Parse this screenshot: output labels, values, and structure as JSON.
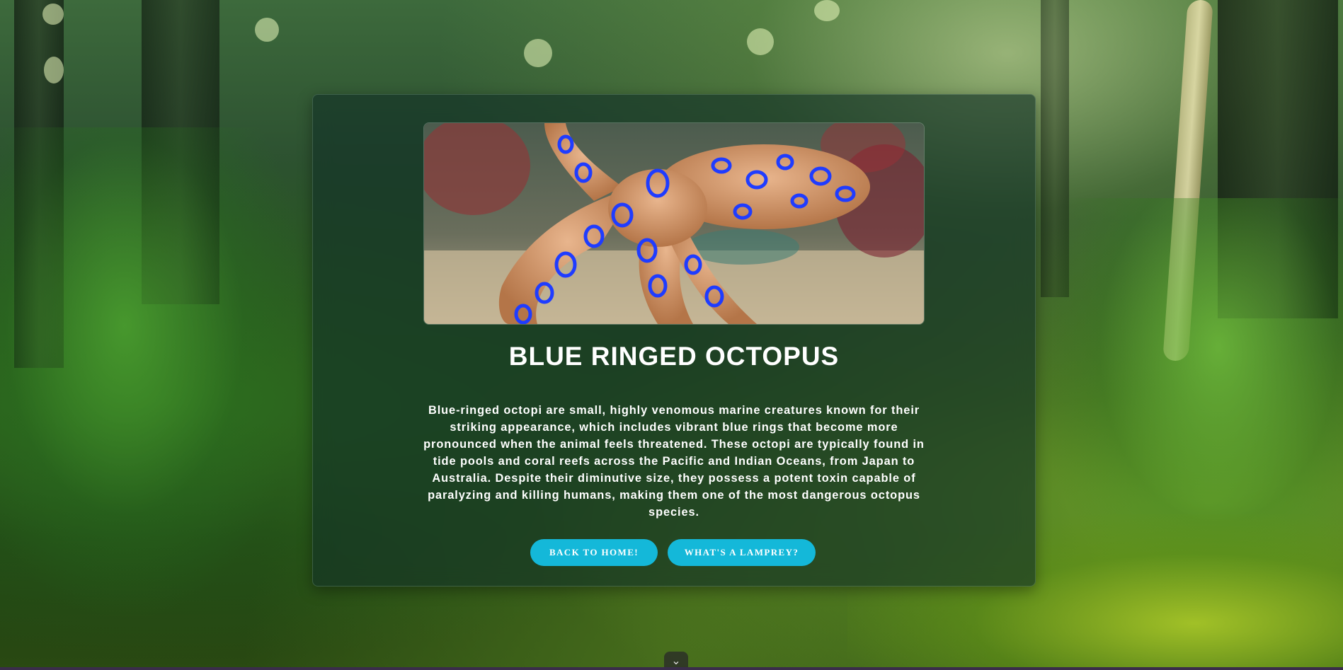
{
  "card": {
    "image_alt": "Blue-ringed octopus on sandy reef",
    "title": "BLUE RINGED OCTOPUS",
    "description": "Blue-ringed octopi are small, highly venomous marine creatures known for their striking appearance, which includes vibrant blue rings that become more pronounced when the animal feels threatened. These octopi are typically found in tide pools and coral reefs across the Pacific and Indian Oceans, from Japan to Australia. Despite their diminutive size, they possess a potent toxin capable of paralyzing and killing humans, making them one of the most dangerous octopus species.",
    "buttons": {
      "home_label": "BACK TO HOME!",
      "lamprey_label": "WHAT'S A LAMPREY?"
    }
  },
  "scroll_indicator": {
    "glyph": "⌄",
    "icon": "chevron-down-icon"
  },
  "colors": {
    "button": "#14b8d9",
    "card_bg": "rgba(18,48,38,0.62)",
    "text": "#ffffff"
  }
}
